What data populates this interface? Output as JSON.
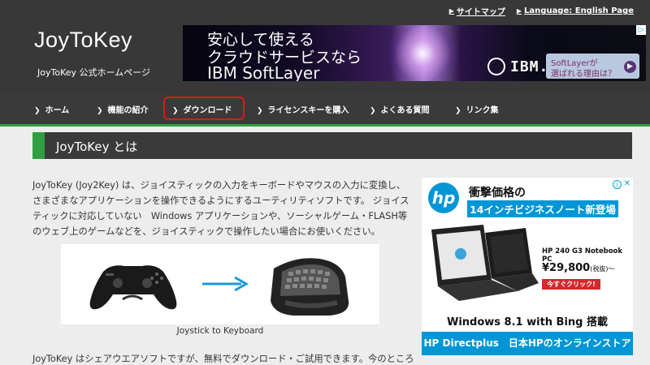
{
  "header": {
    "site_title": "JoyToKey",
    "site_subtitle": "JoyToKey 公式ホームページ",
    "top_links": [
      {
        "label": "サイトマップ"
      },
      {
        "label": "Language: English Page"
      }
    ]
  },
  "banner_ad": {
    "line1": "安心して使える",
    "line2": "クラウドサービスなら",
    "line3": "IBM SoftLayer",
    "brand": "IBM.",
    "cta_line1": "SoftLayerが",
    "cta_line2": "選ばれる理由は？",
    "cta_arrow": "▶"
  },
  "nav": {
    "items": [
      {
        "label": "ホーム"
      },
      {
        "label": "機能の紹介"
      },
      {
        "label": "ダウンロード"
      },
      {
        "label": "ライセンスキーを購入"
      },
      {
        "label": "よくある質問"
      },
      {
        "label": "リンク集"
      }
    ]
  },
  "section": {
    "heading": "JoyToKey とは"
  },
  "article": {
    "paragraph1": "JoyToKey (Joy2Key) は、ジョイスティックの入力をキーボードやマウスの入力に変換し、さまざまなアプリケーションを操作できるようにするユーティリティソフトです。 ジョイスティックに対応していない　Windows アプリケーションや、ソーシャルゲーム・FLASH等のウェブ上のゲームなどを、ジョイスティックで操作したい場合にお使いください。",
    "figure_caption": "Joystick to Keyboard",
    "paragraph2": "JoyToKey はシェアウエアソフトですが、無料でダウンロード・ご試用できます。今のところ"
  },
  "side_ad": {
    "brand": "hp",
    "headline1": "衝撃価格の",
    "headline2": "14インチビジネスノート新登場",
    "model": "HP 240 G3 Notebook PC",
    "price": "¥29,800",
    "price_tax": "(税抜)～",
    "buy_button": "今すぐクリック!",
    "windows_text": "Windows 8.1 with Bing 搭載",
    "footer_bar": "HP Directplus　日本HPのオンラインストア"
  },
  "colors": {
    "header_bg": "#383838",
    "accent_green": "#2ea043",
    "highlight_red": "#e01818",
    "hp_blue": "#0096d6"
  }
}
